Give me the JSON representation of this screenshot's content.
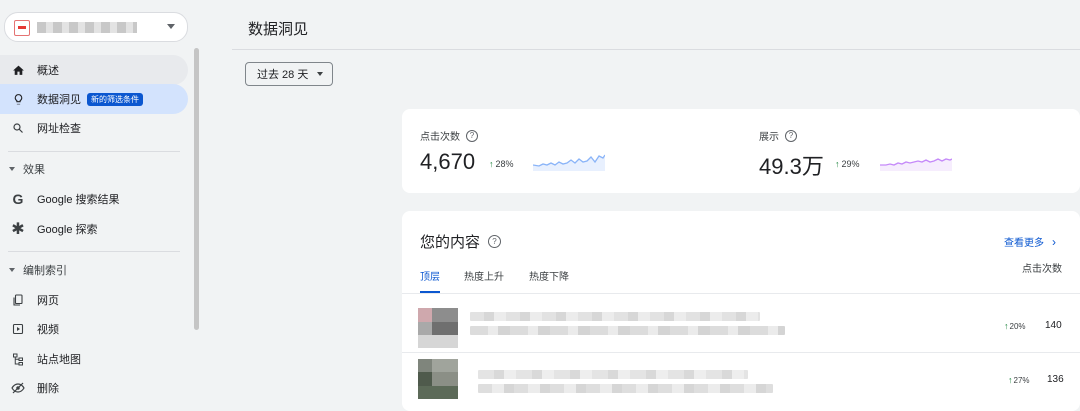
{
  "sidebar": {
    "property_icon": "site-favicon",
    "items_top": [
      {
        "label": "概述",
        "icon": "home-icon"
      },
      {
        "label": "数据洞见",
        "icon": "lightbulb-icon",
        "badge": "新的筛选条件"
      },
      {
        "label": "网址检查",
        "icon": "search-icon"
      }
    ],
    "section_performance": "效果",
    "performance_items": [
      {
        "label": "Google 搜索结果",
        "icon": "google-g-icon"
      },
      {
        "label": "Google 探索",
        "icon": "asterisk-icon"
      }
    ],
    "section_indexing": "编制索引",
    "indexing_items": [
      {
        "label": "网页",
        "icon": "pages-icon"
      },
      {
        "label": "视频",
        "icon": "video-icon"
      },
      {
        "label": "站点地图",
        "icon": "sitemap-icon"
      },
      {
        "label": "删除",
        "icon": "removals-icon"
      }
    ]
  },
  "header": {
    "title": "数据洞见"
  },
  "date_filter": {
    "label": "过去 28 天"
  },
  "metrics": {
    "clicks": {
      "label": "点击次数",
      "value": "4,670",
      "change": "28%",
      "spark_color": "#8ab4f8"
    },
    "impressions": {
      "label": "展示",
      "value": "49.3万",
      "change": "29%",
      "spark_color": "#c58af9"
    }
  },
  "content": {
    "title": "您的内容",
    "more_label": "查看更多",
    "tabs": [
      "顶层",
      "热度上升",
      "热度下降"
    ],
    "column_header": "点击次数",
    "rows": [
      {
        "change": "20%",
        "value": "140"
      },
      {
        "change": "27%",
        "value": "136"
      }
    ]
  },
  "colors": {
    "accent": "#0b57d0",
    "active_nav": "#d3e3fd",
    "positive": "#188038"
  }
}
